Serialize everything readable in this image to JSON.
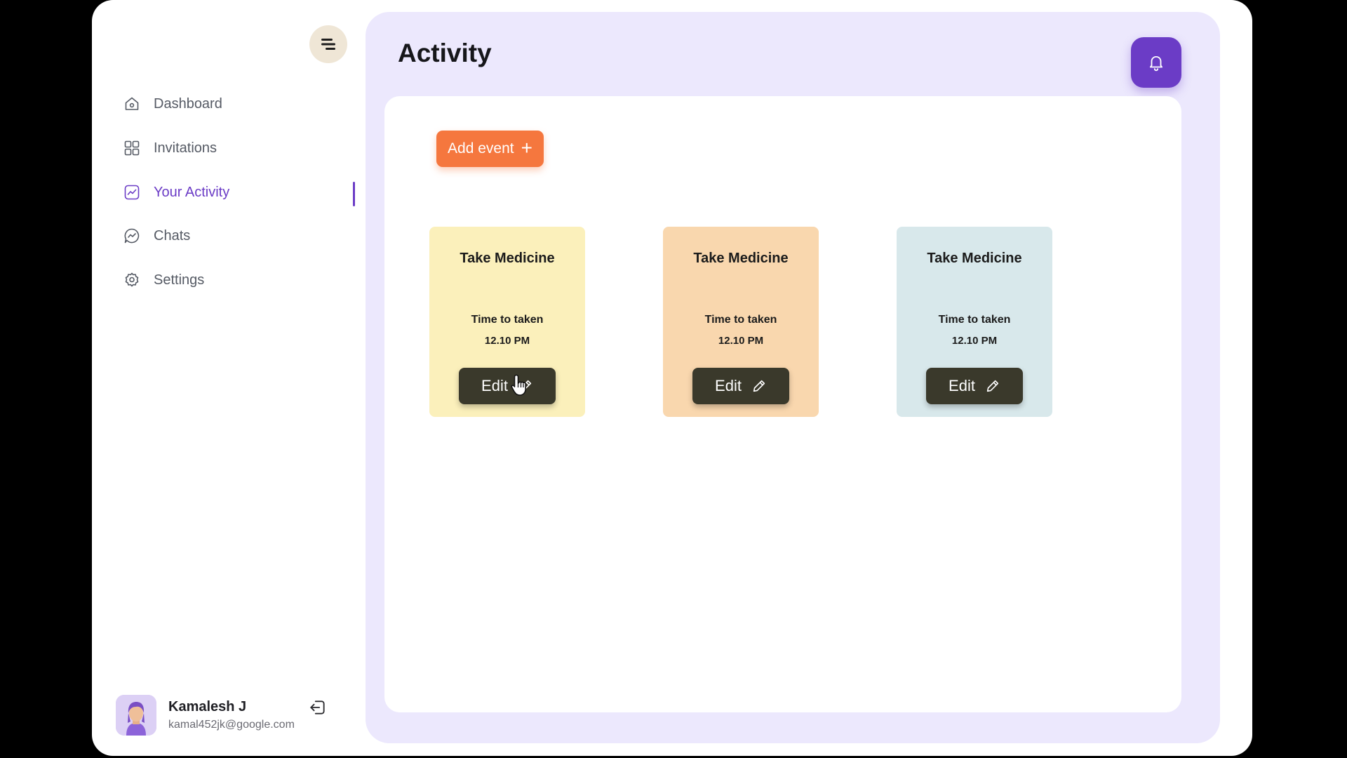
{
  "sidebar": {
    "menu_icon": "menu-lines-icon",
    "items": [
      {
        "label": "Dashboard",
        "icon": "home-icon",
        "active": false
      },
      {
        "label": "Invitations",
        "icon": "grid-icon",
        "active": false
      },
      {
        "label": "Your Activity",
        "icon": "activity-chart-icon",
        "active": true
      },
      {
        "label": "Chats",
        "icon": "chat-bubble-icon",
        "active": false
      },
      {
        "label": "Settings",
        "icon": "gear-icon",
        "active": false
      }
    ],
    "user": {
      "name": "Kamalesh J",
      "email": "kamal452jk@google.com",
      "logout_icon": "logout-icon"
    }
  },
  "main": {
    "title": "Activity",
    "bell_icon": "bell-icon",
    "add_event_label": "Add event",
    "add_event_icon": "+",
    "cards": [
      {
        "title": "Take Medicine",
        "time_label": "Time  to taken",
        "time": "12.10 PM",
        "edit_label": "Edit",
        "color": "#fbf0bb"
      },
      {
        "title": "Take Medicine",
        "time_label": "Time  to taken",
        "time": "12.10 PM",
        "edit_label": "Edit",
        "color": "#f9d7ae"
      },
      {
        "title": "Take Medicine",
        "time_label": "Time  to taken",
        "time": "12.10 PM",
        "edit_label": "Edit",
        "color": "#d8e8eb"
      }
    ]
  },
  "colors": {
    "accent_purple": "#6b3cc6",
    "orange": "#f5773e",
    "dark_button": "#3a392b",
    "main_bg": "#ece8fd"
  }
}
